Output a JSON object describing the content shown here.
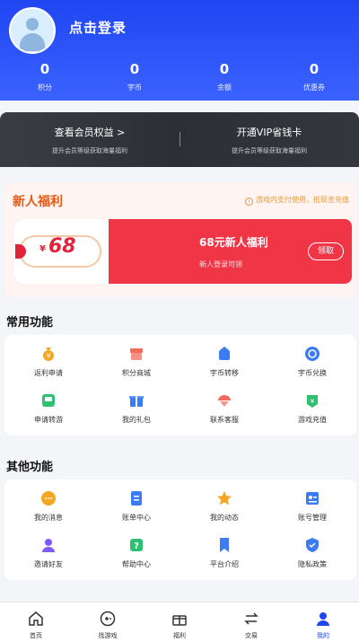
{
  "header": {
    "login_label": "点击登录",
    "stats": [
      {
        "value": "0",
        "label": "积分"
      },
      {
        "value": "0",
        "label": "宇币"
      },
      {
        "value": "0",
        "label": "余额"
      },
      {
        "value": "0",
        "label": "优惠券"
      }
    ]
  },
  "vip": {
    "left_title": "查看会员权益 >",
    "left_sub": "提升会员等级获取海量福利",
    "right_title": "开通VIP省钱卡",
    "right_sub": "提升会员等级获取海量福利"
  },
  "welfare": {
    "title": "新人福利",
    "note": "游戏内支付使用，抵现金充值",
    "coupon_currency": "¥",
    "coupon_amount": "68",
    "coupon_title": "68元新人福利",
    "coupon_sub": "新人登录可领",
    "claim_label": "领取"
  },
  "common": {
    "title": "常用功能",
    "items": [
      {
        "label": "返利申请",
        "icon": "money-bag-icon",
        "color": "#f5a623"
      },
      {
        "label": "积分商城",
        "icon": "shop-icon",
        "color": "#f26b5b"
      },
      {
        "label": "宇币转移",
        "icon": "transfer-icon",
        "color": "#3b7cf5"
      },
      {
        "label": "宇币兑换",
        "icon": "exchange-icon",
        "color": "#3b7cf5"
      },
      {
        "label": "申请转游",
        "icon": "switch-game-icon",
        "color": "#2fbf71"
      },
      {
        "label": "我的礼包",
        "icon": "gift-icon",
        "color": "#3b7cf5"
      },
      {
        "label": "联系客服",
        "icon": "customer-service-icon",
        "color": "#f26b5b"
      },
      {
        "label": "游戏充值",
        "icon": "recharge-icon",
        "color": "#2fbf71"
      }
    ]
  },
  "other": {
    "title": "其他功能",
    "items": [
      {
        "label": "我的消息",
        "icon": "message-icon",
        "color": "#f5a623"
      },
      {
        "label": "账单中心",
        "icon": "bill-icon",
        "color": "#3b7cf5"
      },
      {
        "label": "我的动态",
        "icon": "star-icon",
        "color": "#f5a623"
      },
      {
        "label": "账号管理",
        "icon": "account-card-icon",
        "color": "#3b7cf5"
      },
      {
        "label": "邀请好友",
        "icon": "invite-icon",
        "color": "#7c5cf5"
      },
      {
        "label": "帮助中心",
        "icon": "help-icon",
        "color": "#2fbf71"
      },
      {
        "label": "平台介绍",
        "icon": "bookmark-icon",
        "color": "#3b7cf5"
      },
      {
        "label": "隐私政策",
        "icon": "shield-icon",
        "color": "#3b7cf5"
      }
    ]
  },
  "nav": [
    {
      "label": "首页",
      "icon": "home-icon"
    },
    {
      "label": "找游戏",
      "icon": "gamepad-icon"
    },
    {
      "label": "福利",
      "icon": "welfare-icon"
    },
    {
      "label": "交易",
      "icon": "trade-icon"
    },
    {
      "label": "我的",
      "icon": "user-icon"
    }
  ],
  "colors": {
    "primary": "#1f46f2",
    "accent": "#f03547",
    "orange": "#e55a16"
  }
}
